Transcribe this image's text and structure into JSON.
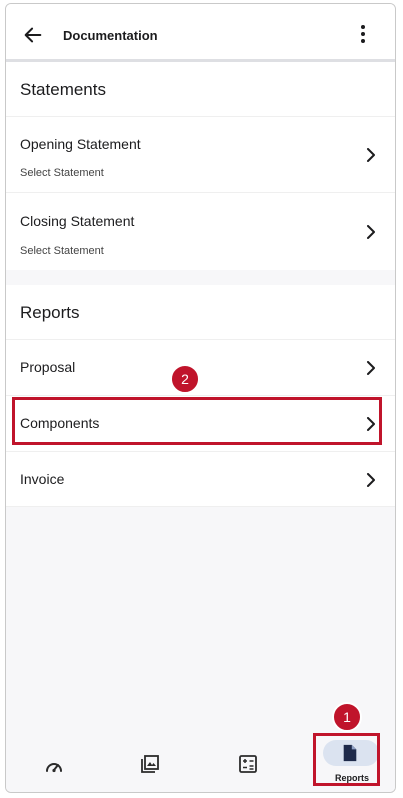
{
  "header": {
    "title": "Documentation",
    "back_icon": "arrow-left-icon",
    "menu_icon": "more-vertical-icon"
  },
  "statements": {
    "heading": "Statements",
    "items": [
      {
        "label": "Opening Statement",
        "sub": "Select Statement"
      },
      {
        "label": "Closing Statement",
        "sub": "Select Statement"
      }
    ]
  },
  "reports": {
    "heading": "Reports",
    "items": [
      {
        "label": "Proposal"
      },
      {
        "label": "Components"
      },
      {
        "label": "Invoice"
      }
    ]
  },
  "bottom_nav": {
    "items": [
      {
        "icon": "speedometer-icon"
      },
      {
        "icon": "gallery-icon"
      },
      {
        "icon": "calculator-icon"
      },
      {
        "icon": "document-icon",
        "label": "Reports",
        "active": true
      }
    ]
  },
  "callouts": {
    "first": "1",
    "second": "2"
  },
  "colors": {
    "highlight": "#c0142b",
    "active_pill": "#dbe3f0"
  }
}
